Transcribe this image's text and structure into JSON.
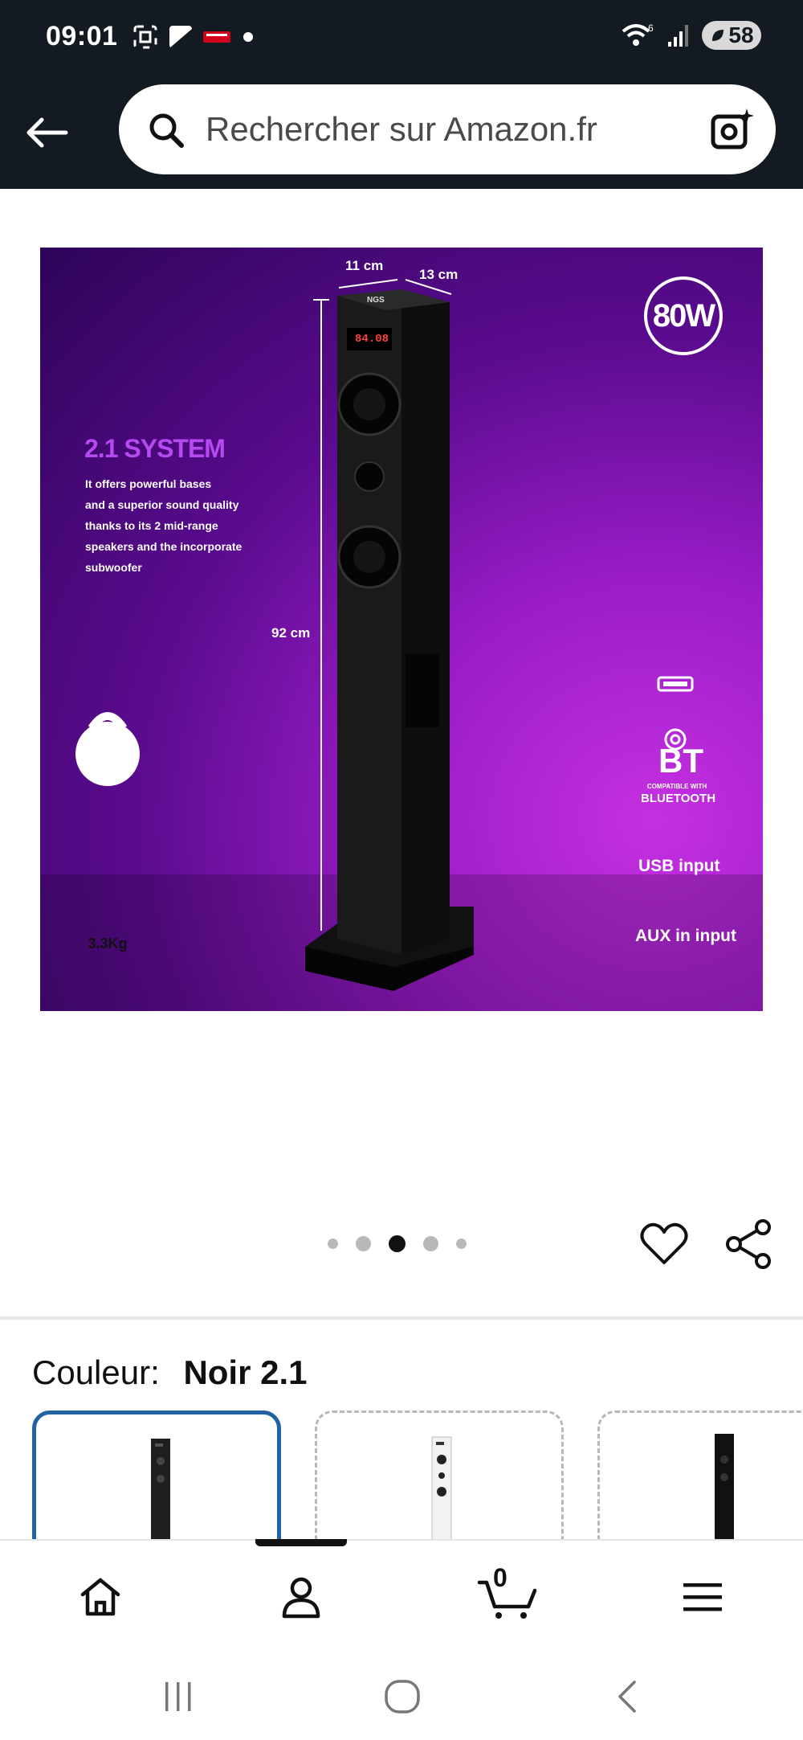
{
  "status_bar": {
    "time": "09:01",
    "battery": "58",
    "icons": [
      "screenshot-icon",
      "gallery-icon",
      "notification-app-icon",
      "dot-icon",
      "wifi-6-icon",
      "signal-icon",
      "battery-icon"
    ]
  },
  "search": {
    "placeholder": "Rechercher sur Amazon.fr",
    "back_icon": "back-arrow-icon",
    "search_icon": "search-icon",
    "camera_icon": "camera-sparkle-icon"
  },
  "product_image": {
    "dim_width": "11 cm",
    "dim_depth": "13 cm",
    "dim_height": "92 cm",
    "power_badge": "80W",
    "feature_title": "2.1 SYSTEM",
    "feature_text_lines": [
      "It offers powerful bases",
      "and a superior sound quality",
      "thanks to its 2 mid-range",
      "speakers and the incorporate",
      "subwoofer"
    ],
    "bt_label": "BT",
    "bt_compat_line1": "COMPATIBLE WITH",
    "bt_compat_line2": "BLUETOOTH",
    "usb_label": "USB input",
    "aux_label": "AUX in input",
    "weight_label": "3.3Kg",
    "brand_label": "NGS",
    "display_readout": "84.08",
    "colors": {
      "bg_dark": "#2d0458",
      "bg_light": "#c530e0",
      "title_violet": "#b44af0"
    }
  },
  "gallery": {
    "image_count": 5,
    "active_index": 2
  },
  "color_selector": {
    "label": "Couleur:",
    "selected_value": "Noir 2.1",
    "accent": "#2162a1"
  },
  "bottom_nav": {
    "cart_count": "0",
    "items": [
      "home-icon",
      "account-icon",
      "cart-icon",
      "menu-icon"
    ]
  }
}
